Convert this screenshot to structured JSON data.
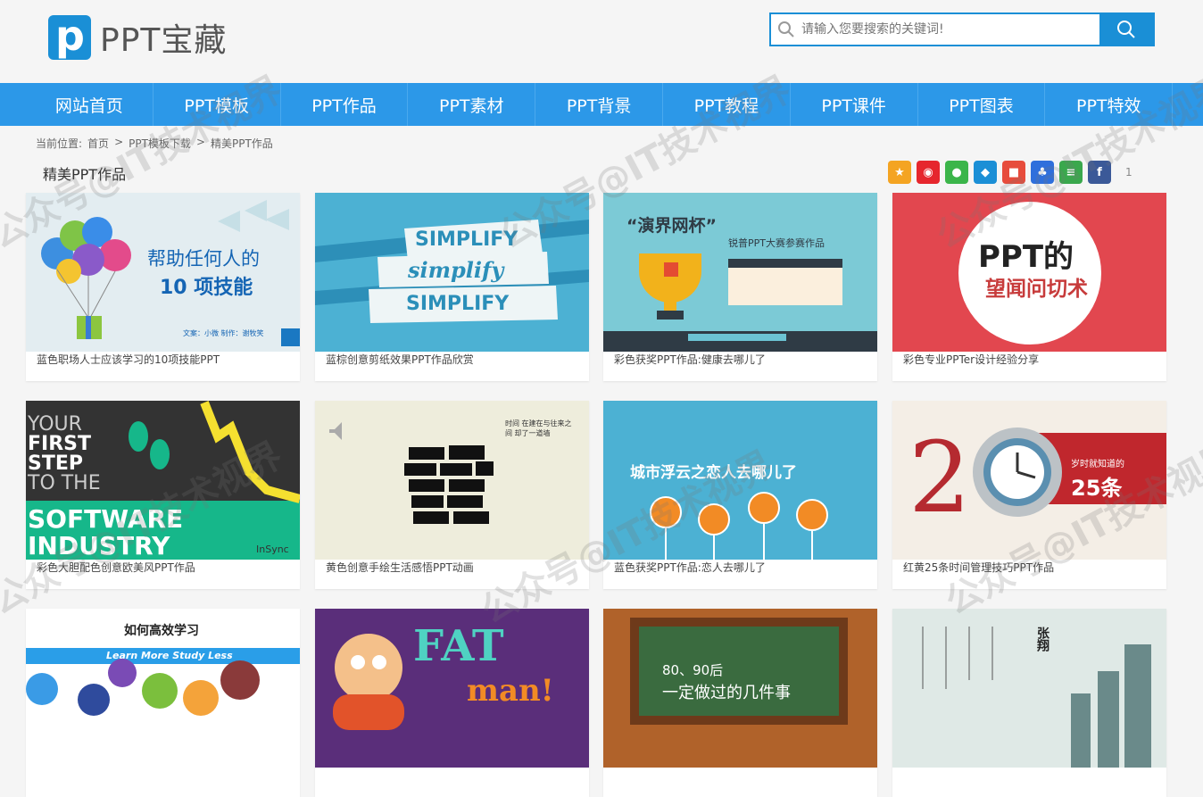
{
  "site": {
    "logo_letter": "p",
    "logo_text": "PPT宝藏"
  },
  "search": {
    "placeholder": "请输入您要搜索的关键词!"
  },
  "nav": [
    "网站首页",
    "PPT模板",
    "PPT作品",
    "PPT素材",
    "PPT背景",
    "PPT教程",
    "PPT课件",
    "PPT图表",
    "PPT特效"
  ],
  "breadcrumb": {
    "prefix": "当前位置:",
    "items": [
      "首页",
      ">",
      "PPT模板下载",
      ">",
      "精美PPT作品"
    ]
  },
  "section_title": "精美PPT作品",
  "share": {
    "icons": [
      "qzone-icon",
      "weibo-icon",
      "wechat-icon",
      "tqq-icon",
      "renren-icon",
      "baidu-icon",
      "douban-icon",
      "facebook-icon"
    ],
    "count": "1"
  },
  "cards": [
    {
      "caption": "蓝色职场人士应该学习的10项技能PPT",
      "thumb": {
        "line1": "帮助任何人的",
        "line2": "10 项技能",
        "footer": "文案：小微    制作：谢牧笑"
      }
    },
    {
      "caption": "蓝棕创意剪纸效果PPT作品欣赏",
      "thumb": {
        "w1": "SIMPLIFY",
        "w2": "simplify",
        "w3": "SIMPLIFY"
      }
    },
    {
      "caption": "彩色获奖PPT作品:健康去哪儿了",
      "thumb": {
        "title": "“演界网杯”",
        "sub": "锐普PPT大赛参赛作品"
      }
    },
    {
      "caption": "彩色专业PPTer设计经验分享",
      "thumb": {
        "line1": "PPT的",
        "line2": "望闻问切术"
      }
    },
    {
      "caption": "彩色大胆配色创意欧美风PPT作品",
      "thumb": {
        "l1": "YOUR",
        "l2": "FIRST",
        "l3": "STEP",
        "l4": "TO THE",
        "l5": "SOFTWARE",
        "l6": "INDUSTRY",
        "brand": "InSync"
      }
    },
    {
      "caption": "黄色创意手绘生活感悟PPT动画",
      "thumb": {
        "note": "时间 在建在与往来之间 却了一道墙"
      }
    },
    {
      "caption": "蓝色获奖PPT作品:恋人去哪儿了",
      "thumb": {
        "title": "城市浮云之恋人去哪儿了"
      }
    },
    {
      "caption": "红黄25条时间管理技巧PPT作品",
      "thumb": {
        "big": "2",
        "small": "岁时就知道的",
        "num": "25条"
      }
    },
    {
      "caption": "",
      "thumb": {
        "title": "如何高效学习",
        "banner": "Learn More  Study Less"
      }
    },
    {
      "caption": "",
      "thumb": {
        "w1": "FAT",
        "w2": "man!"
      }
    },
    {
      "caption": "",
      "thumb": {
        "l1": "80、90后",
        "l2": "一定做过的几件事"
      }
    },
    {
      "caption": "",
      "thumb": {
        "sig": "张翔"
      }
    }
  ],
  "watermark": "公众号@IT技术视界",
  "colors": {
    "brand": "#1a8fd6",
    "nav": "#2c98e8"
  }
}
